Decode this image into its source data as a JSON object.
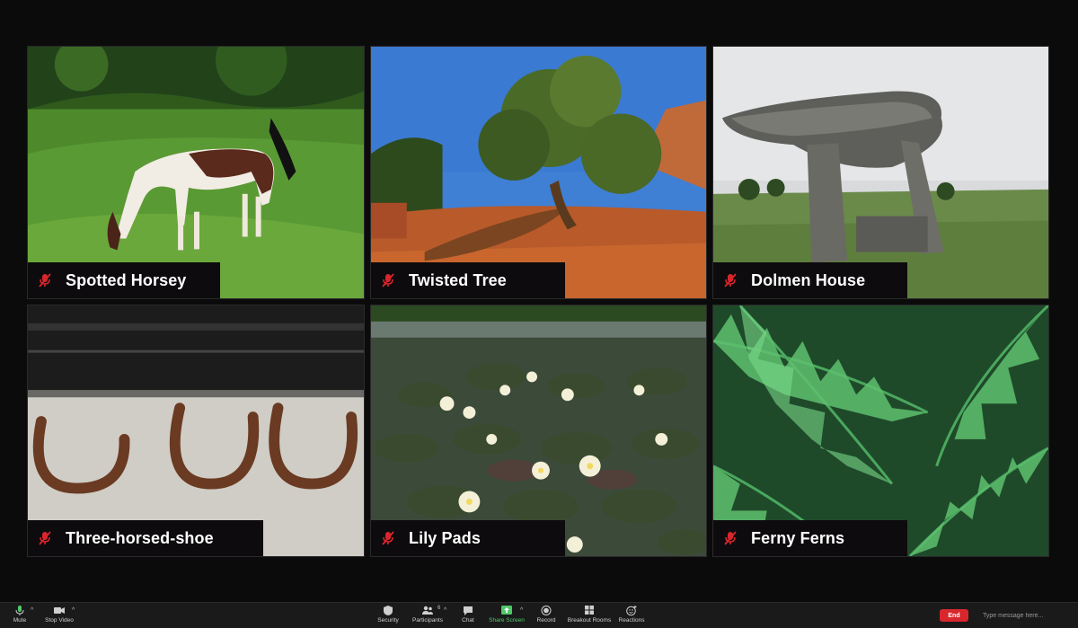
{
  "participants": [
    {
      "name": "Spotted Horsey"
    },
    {
      "name": "Twisted Tree"
    },
    {
      "name": "Dolmen House"
    },
    {
      "name": "Three-horsed-shoe"
    },
    {
      "name": "Lily Pads"
    },
    {
      "name": "Ferny Ferns"
    }
  ],
  "toolbar": {
    "mute": "Mute",
    "stop_video": "Stop Video",
    "security": "Security",
    "participants": "Participants",
    "participants_count": "6",
    "chat": "Chat",
    "share_screen": "Share Screen",
    "record": "Record",
    "breakout_rooms": "Breakout Rooms",
    "reactions": "Reactions",
    "end": "End",
    "message_placeholder": "Type message here..."
  },
  "colors": {
    "end_button": "#d8262d",
    "share_screen_green": "#4ec96a",
    "muted_mic_red": "#d8262d"
  }
}
